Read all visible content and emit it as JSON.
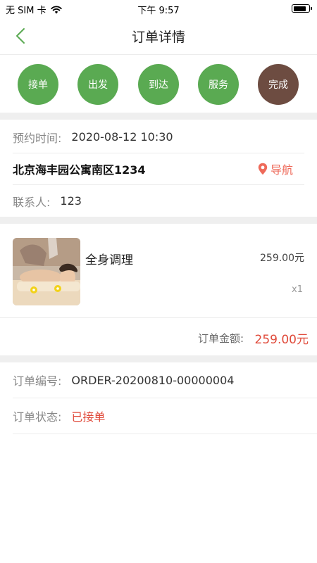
{
  "status_bar": {
    "carrier": "无 SIM 卡",
    "time": "下午 9:57",
    "battery_level": 0.85
  },
  "header": {
    "title": "订单详情"
  },
  "steps": [
    {
      "label": "接单",
      "color": "#5aaa52"
    },
    {
      "label": "出发",
      "color": "#5aaa52"
    },
    {
      "label": "到达",
      "color": "#5aaa52"
    },
    {
      "label": "服务",
      "color": "#5aaa52"
    },
    {
      "label": "完成",
      "color": "#6d4c41"
    }
  ],
  "appointment": {
    "label": "预约时间:",
    "value": "2020-08-12 10:30"
  },
  "address": {
    "text": "北京海丰园公寓南区1234",
    "nav_label": "导航"
  },
  "contact": {
    "label": "联系人:",
    "value": "123"
  },
  "product": {
    "name": "全身调理",
    "price": "259.00元",
    "quantity": "x1"
  },
  "total": {
    "label": "订单金额:",
    "value": "259.00元"
  },
  "order_number": {
    "label": "订单编号:",
    "value": "ORDER-20200810-00000004"
  },
  "order_status": {
    "label": "订单状态:",
    "value": "已接单"
  },
  "colors": {
    "accent_green": "#5aaa52",
    "done_brown": "#6d4c41",
    "price_red": "#e04a3a",
    "nav_red": "#ee6a5a"
  }
}
